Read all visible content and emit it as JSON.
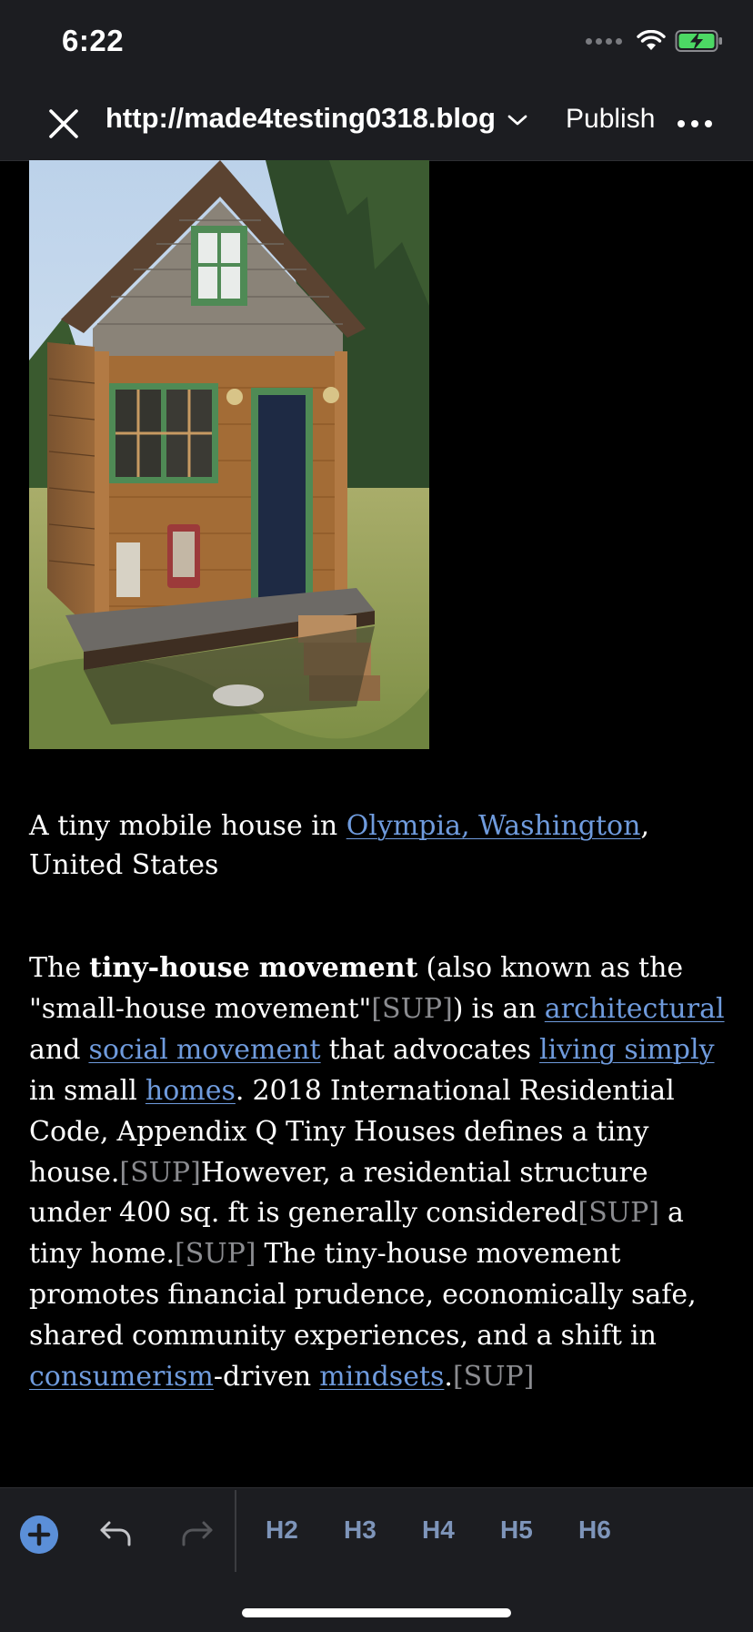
{
  "status_bar": {
    "time": "6:22",
    "icons": [
      "cellular-dots-icon",
      "wifi-icon",
      "battery-charging-icon"
    ]
  },
  "nav": {
    "close_icon": "close-icon",
    "site_url": "http://made4testing0318.blog",
    "site_chevron_icon": "chevron-down-icon",
    "publish_label": "Publish",
    "more_icon": "more-horizontal-icon"
  },
  "content": {
    "image_alt": "A tiny mobile house",
    "caption": {
      "before": "A tiny mobile house in ",
      "link": "Olympia, Washington",
      "after": ", United States"
    },
    "paragraph": {
      "s1": "The ",
      "bold": "tiny-house movement",
      "s2": " (also known as the \"small-house movement\"",
      "sup1": "[SUP]",
      "s3": ") is an ",
      "link_architectural": "architectural",
      "s4": " and ",
      "link_social": "social movement",
      "s5": " that advocates ",
      "link_living": "living simply",
      "s6": " in small ",
      "link_homes": "homes",
      "s7": ". 2018 International Residential Code, Appendix Q Tiny Houses defines a tiny house.",
      "sup2": "[SUP]",
      "s8": "However, a residential structure under 400 sq. ft is generally considered",
      "sup3": "[SUP]",
      "s9": " a tiny home.",
      "sup4": "[SUP]",
      "s10": " The tiny-house movement promotes financial prudence, economically safe, shared community experiences, and a shift in ",
      "link_consumerism": "consumerism",
      "s11": "-driven ",
      "link_mindsets": "mindsets",
      "s12": ".",
      "sup5": "[SUP]"
    }
  },
  "toolbar": {
    "add_icon": "plus-circle-icon",
    "undo_icon": "undo-icon",
    "redo_icon": "redo-icon",
    "headings": [
      "H2",
      "H3",
      "H4",
      "H5",
      "H6"
    ]
  },
  "colors": {
    "background": "#000000",
    "bar_background": "#1c1d21",
    "link": "#6f9bdd",
    "sup": "#8b8c90",
    "accent": "#5b8fd8",
    "heading_buttons": "#7e95ba"
  }
}
